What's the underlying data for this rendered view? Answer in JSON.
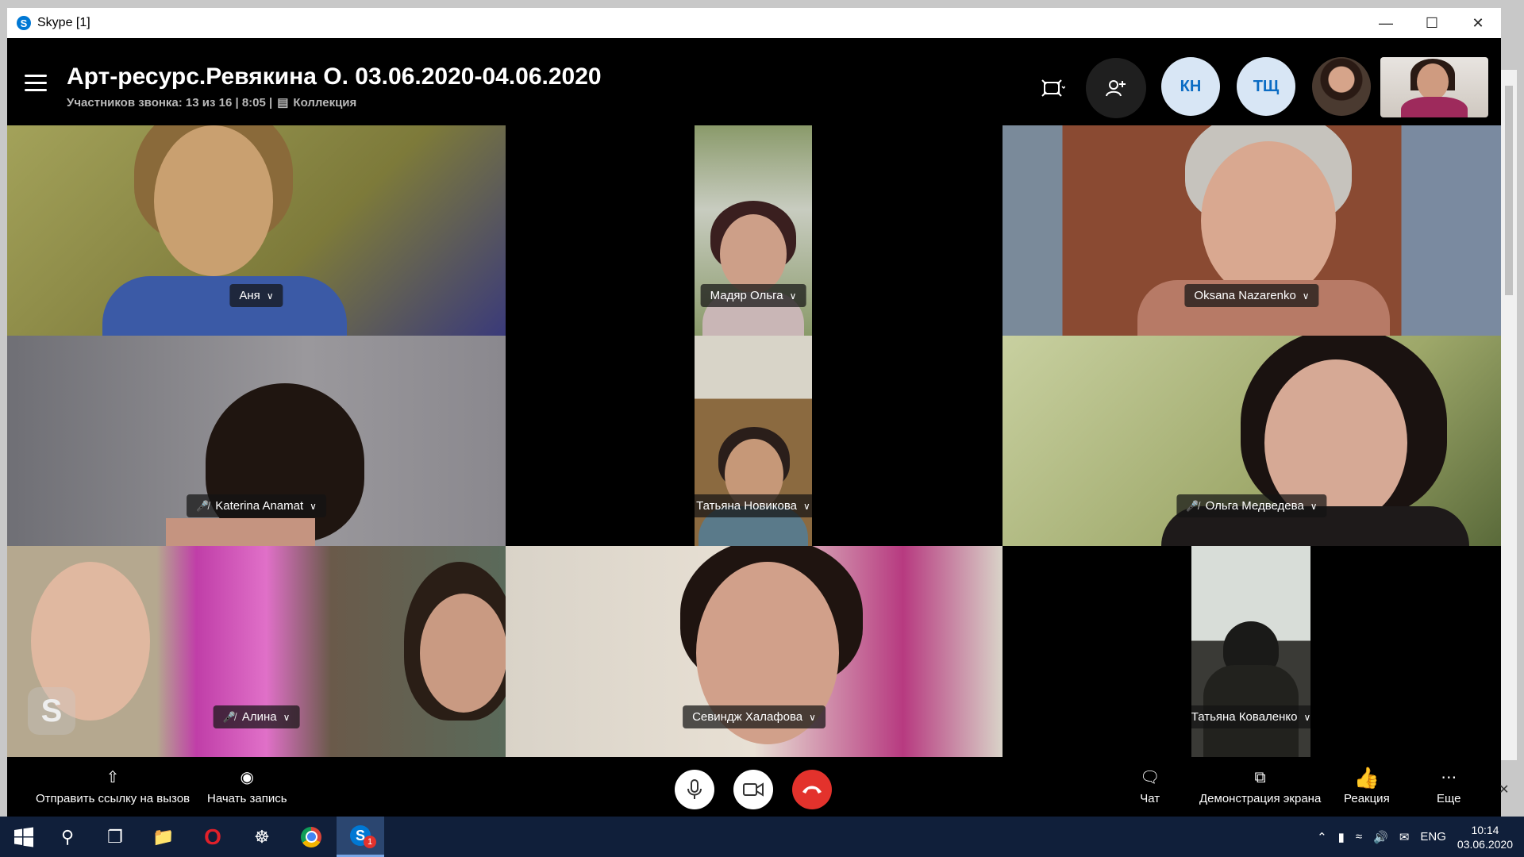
{
  "window": {
    "title": "Skype [1]",
    "controls": {
      "minimize": "—",
      "maximize": "☐",
      "close": "✕"
    }
  },
  "header": {
    "call_title": "Арт-ресурс.Ревякина О. 03.06.2020-04.06.2020",
    "participants": "Участников звонка: 13 из 16 | 8:05 |",
    "collection": "Коллекция",
    "avatars": [
      {
        "initials": "КН"
      },
      {
        "initials": "ТЩ"
      }
    ]
  },
  "tiles": [
    {
      "name": "Аня",
      "muted": false,
      "bg": "#8a8a3a"
    },
    {
      "name": "Мадяр Ольга",
      "muted": false,
      "bg": "#6f7f5a"
    },
    {
      "name": "Oksana Nazarenko",
      "muted": false,
      "bg": "#8a4a32"
    },
    {
      "name": "Katerina Anamat",
      "muted": true,
      "bg": "#8e8c8e"
    },
    {
      "name": "Татьяна Новикова",
      "muted": false,
      "bg": "#8b6a40"
    },
    {
      "name": "Ольга Медведева",
      "muted": true,
      "bg": "#9ea86a"
    },
    {
      "name": "Алина",
      "muted": true,
      "bg": "#7a6a5a"
    },
    {
      "name": "Севиндж Халафова",
      "muted": false,
      "bg": "#b9a995"
    },
    {
      "name": "Татьяна Коваленко",
      "muted": false,
      "bg": "#3a3a36"
    }
  ],
  "controls": {
    "share_link": "Отправить ссылку на вызов",
    "start_recording": "Начать запись",
    "chat": "Чат",
    "screen_share": "Демонстрация экрана",
    "reaction": "Реакция",
    "more": "Еще"
  },
  "taskbar": {
    "language": "ENG",
    "time": "10:14",
    "date": "03.06.2020",
    "skype_badge": "1"
  },
  "colors": {
    "accent": "#0078d4",
    "end_call": "#e3322c",
    "taskbar": "#101f3a"
  }
}
